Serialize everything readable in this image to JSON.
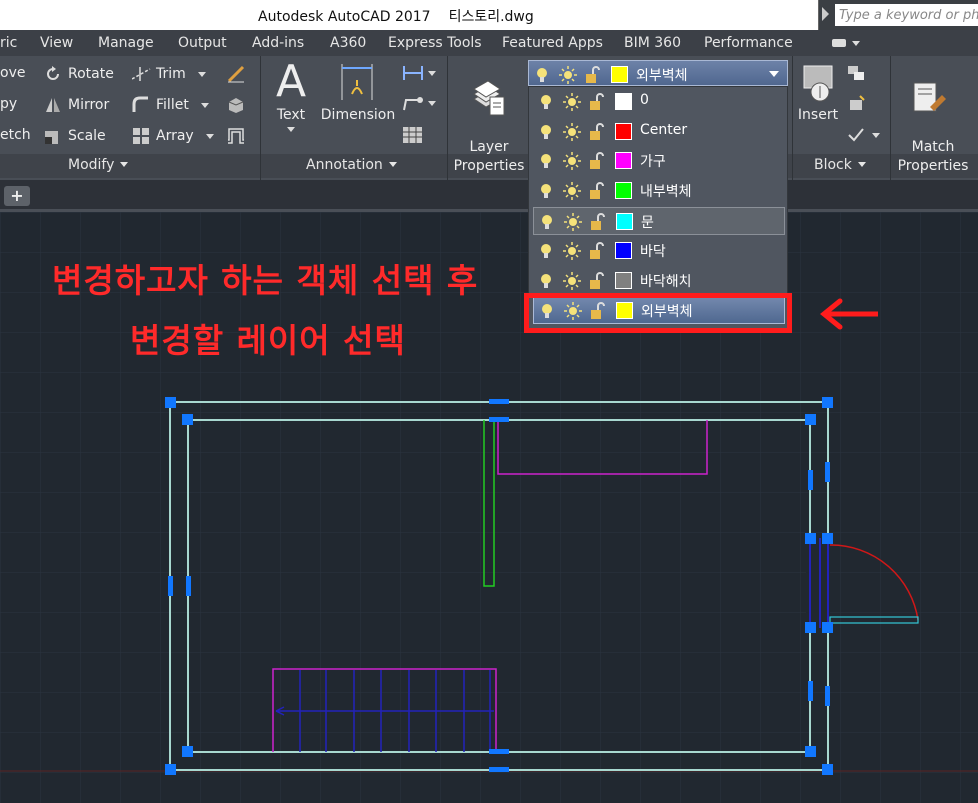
{
  "titlebar": {
    "app_title": "Autodesk AutoCAD 2017",
    "file_name": "티스토리.dwg",
    "search_placeholder": "Type a keyword or ph"
  },
  "menu_tabs": [
    "ric",
    "View",
    "Manage",
    "Output",
    "Add-ins",
    "A360",
    "Express Tools",
    "Featured Apps",
    "BIM 360",
    "Performance"
  ],
  "modify_panel": {
    "title": "Modify",
    "col1": [
      "ove",
      "py",
      "etch"
    ],
    "col2": [
      "Rotate",
      "Mirror",
      "Scale"
    ],
    "col3": [
      "Trim",
      "Fillet",
      "Array"
    ]
  },
  "annotation_panel": {
    "title": "Annotation",
    "text_label": "Text",
    "dimension_label": "Dimension"
  },
  "layers_panel": {
    "layer_properties_label": "Layer\nProperties",
    "current_layer": "외부벽체"
  },
  "block_panel": {
    "title": "Block",
    "insert_label": "Insert"
  },
  "properties_panel": {
    "match_label": "Match\nProperties"
  },
  "layers": [
    {
      "name": "0",
      "color": "#ffffff"
    },
    {
      "name": "Center",
      "color": "#ff0000"
    },
    {
      "name": "가구",
      "color": "#ff00ff"
    },
    {
      "name": "내부벽체",
      "color": "#00ff00"
    },
    {
      "name": "문",
      "color": "#00ffff"
    },
    {
      "name": "바닥",
      "color": "#0000ff"
    },
    {
      "name": "바닥해치",
      "color": "#808080"
    },
    {
      "name": "외부벽체",
      "color": "#ffff00"
    }
  ],
  "current_layer_color": "#ffff00",
  "highlighted_layer_index": 4,
  "selected_layer_index": 7,
  "annotation": {
    "line1": "변경하고자 하는 객체 선택 후",
    "line2": "변경할 레이어 선택",
    "color": "#ff2a2a"
  },
  "colors": {
    "canvas_bg": "#212830",
    "wall": "#a8d8d0",
    "grip": "#1177ff",
    "interior_wall": "#22cc22",
    "furniture": "#cc22cc",
    "floor": "#2222bb",
    "door_arc": "#d01818"
  }
}
